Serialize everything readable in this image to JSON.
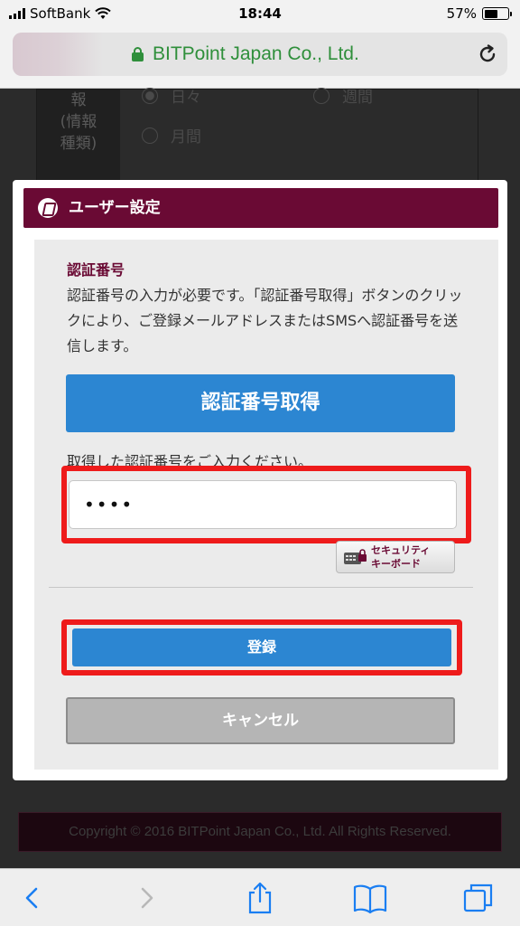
{
  "status_bar": {
    "carrier": "SoftBank",
    "time": "18:44",
    "battery_percent": "57%",
    "battery_level": 0.57
  },
  "address_bar": {
    "url_text": "BITPoint Japan Co., Ltd."
  },
  "background_page": {
    "label_cell": "報\n(情報\n種類)",
    "radio_options": [
      "日々",
      "週間",
      "月間"
    ],
    "selected_option": "日々",
    "footer": "Copyright © 2016 BITPoint Japan Co., Ltd. All Rights Reserved."
  },
  "modal": {
    "title": "ユーザー設定",
    "section_title": "認証番号",
    "description": "認証番号の入力が必要です。「認証番号取得」ボタンのクリックにより、ご登録メールアドレスまたはSMSへ認証番号を送信します。",
    "get_code_button": "認証番号取得",
    "input_prompt": "取得した認証番号をご入力ください。",
    "code_input_value": "••••",
    "security_keyboard_label": "セキュリティ\nキーボード",
    "register_button": "登録",
    "cancel_button": "キャンセル",
    "accent_color": "#6a0a34",
    "button_color": "#2c86d2",
    "highlight_color": "#ee1b1b"
  },
  "toolbar": {
    "icons": [
      "back-icon",
      "forward-icon",
      "share-icon",
      "bookmarks-icon",
      "tabs-icon"
    ]
  }
}
